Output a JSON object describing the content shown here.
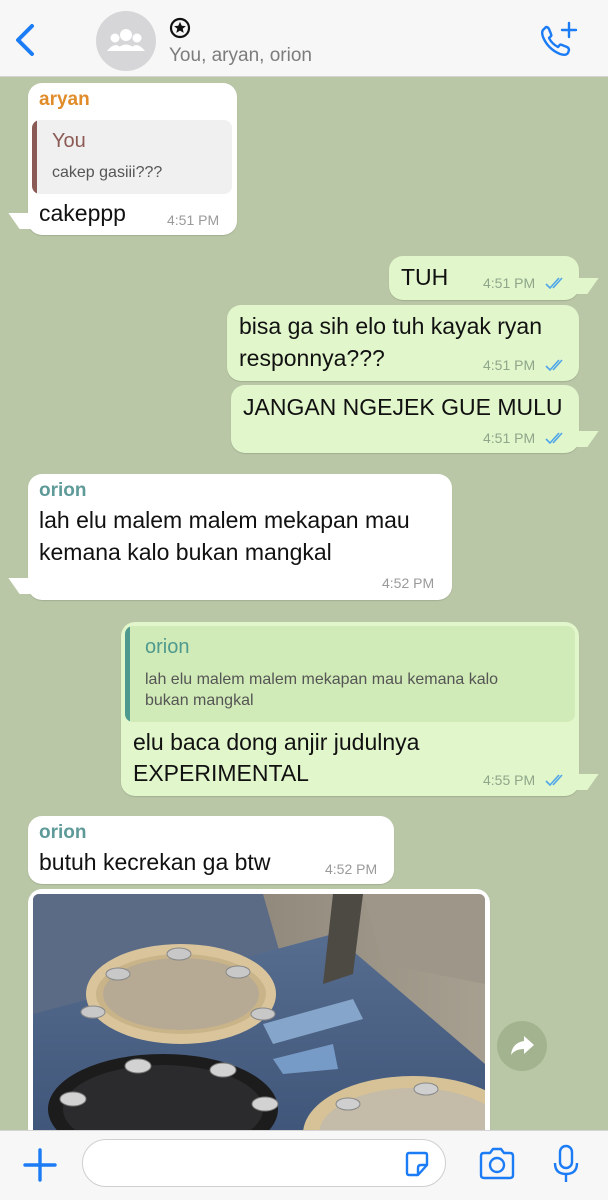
{
  "header": {
    "group_name_symbol": "✪",
    "participants": "You, aryan, orion"
  },
  "messages": [
    {
      "sender": "aryan",
      "quote_author": "You",
      "quote_text": "cakep gasiii???",
      "text": "cakeppp",
      "time": "4:51 PM"
    },
    {
      "text": "TUH",
      "time": "4:51 PM"
    },
    {
      "text_line1": "bisa ga sih elo tuh kayak ryan",
      "text_line2": "responnya???",
      "time": "4:51 PM"
    },
    {
      "text": "JANGAN NGEJEK GUE MULU",
      "time": "4:51 PM"
    },
    {
      "sender": "orion",
      "text_line1": "lah elu malem malem mekapan mau",
      "text_line2": "kemana kalo bukan mangkal",
      "time": "4:52 PM"
    },
    {
      "quote_author": "orion",
      "quote_line1": "lah elu malem malem mekapan mau kemana kalo",
      "quote_line2": "bukan mangkal",
      "text_line1": "elu baca dong anjir judulnya",
      "text_line2": "EXPERIMENTAL",
      "time": "4:55 PM"
    },
    {
      "sender": "orion",
      "text": "butuh kecrekan ga btw",
      "time": "4:52 PM"
    }
  ],
  "composer": {
    "value": "",
    "placeholder": ""
  },
  "colors": {
    "chat_bg": "#b9c7a6",
    "outgoing": "#e1f6cb",
    "incoming": "#ffffff",
    "accent": "#1b7cf6",
    "read_ticks": "#4fa6e8"
  }
}
